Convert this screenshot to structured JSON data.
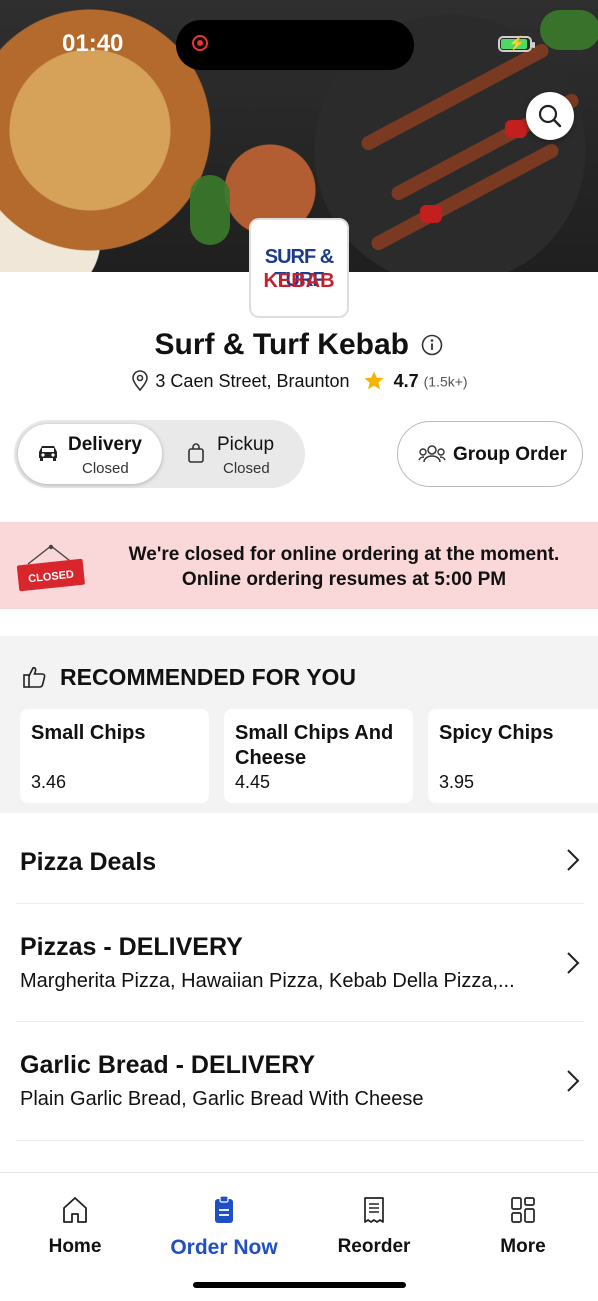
{
  "status_bar": {
    "time": "01:40"
  },
  "hero": {
    "search_icon": "search-icon"
  },
  "logo": {
    "line1": "SURF & TURF",
    "line2": "KEBAB"
  },
  "restaurant": {
    "name": "Surf & Turf Kebab",
    "address": "3 Caen Street, Braunton",
    "rating": "4.7",
    "rating_count": "(1.5k+)"
  },
  "order_mode": {
    "delivery": {
      "label": "Delivery",
      "status": "Closed"
    },
    "pickup": {
      "label": "Pickup",
      "status": "Closed"
    },
    "group_order": "Group Order"
  },
  "closed_banner": {
    "sign_text": "CLOSED",
    "line1": "We're closed for online ordering at the moment.",
    "line2": "Online ordering resumes at 5:00 PM"
  },
  "recommended": {
    "title": "RECOMMENDED FOR YOU",
    "items": [
      {
        "name": "Small Chips",
        "price": "3.46"
      },
      {
        "name": "Small Chips And Cheese",
        "price": "4.45"
      },
      {
        "name": "Spicy Chips",
        "price": "3.95"
      }
    ]
  },
  "menu": [
    {
      "title": "Pizza Deals",
      "desc": ""
    },
    {
      "title": "Pizzas - DELIVERY",
      "desc": "Margherita Pizza, Hawaiian Pizza, Kebab Della Pizza,..."
    },
    {
      "title": "Garlic Bread - DELIVERY",
      "desc": "Plain Garlic Bread, Garlic Bread With Cheese"
    }
  ],
  "bottom_nav": [
    {
      "label": "Home",
      "icon": "home-icon"
    },
    {
      "label": "Order Now",
      "icon": "order-icon"
    },
    {
      "label": "Reorder",
      "icon": "receipt-icon"
    },
    {
      "label": "More",
      "icon": "grid-icon"
    }
  ],
  "colors": {
    "accent": "#1f4fc4",
    "banner_bg": "#fad7d8",
    "star": "#f5b400",
    "closed_red": "#d9262c"
  }
}
